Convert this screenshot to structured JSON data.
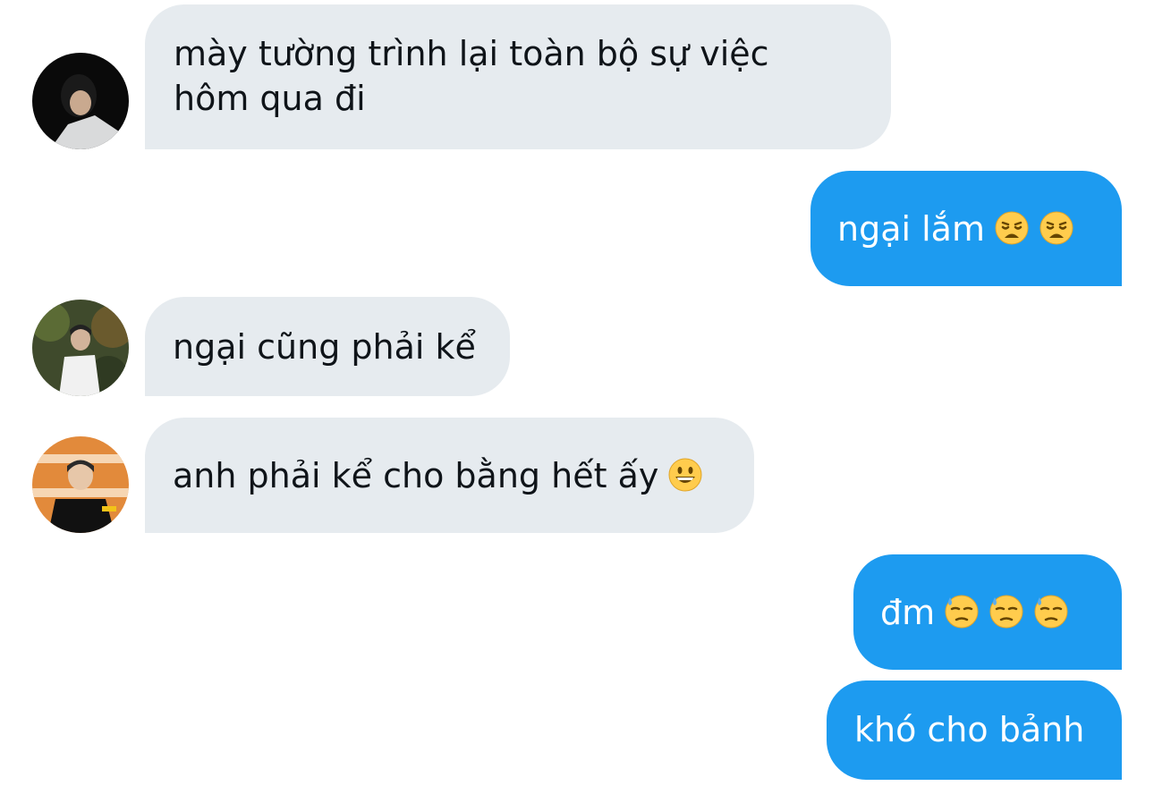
{
  "messages": [
    {
      "id": "m1",
      "direction": "incoming",
      "lines": [
        "mày tường trình lại toàn bộ sự việc",
        "hôm qua đi"
      ],
      "emojis": []
    },
    {
      "id": "m2",
      "direction": "outgoing",
      "text": "ngại lắm",
      "emojis": [
        "weary-face-emoji",
        "weary-face-emoji"
      ]
    },
    {
      "id": "m3",
      "direction": "incoming",
      "text": "ngại cũng phải kể",
      "emojis": []
    },
    {
      "id": "m4",
      "direction": "incoming",
      "text": "anh phải kể cho bằng hết ấy",
      "emojis": [
        "grinning-face-emoji"
      ]
    },
    {
      "id": "m5",
      "direction": "outgoing",
      "text": "đm",
      "emojis": [
        "downcast-sweat-face-emoji",
        "downcast-sweat-face-emoji",
        "downcast-sweat-face-emoji"
      ]
    },
    {
      "id": "m6",
      "direction": "outgoing",
      "text": "khó cho bảnh",
      "emojis": []
    }
  ],
  "colors": {
    "incoming_bubble": "#e6ebef",
    "incoming_text": "#0f1419",
    "outgoing_bubble": "#1d9bf0",
    "outgoing_text": "#ffffff"
  }
}
